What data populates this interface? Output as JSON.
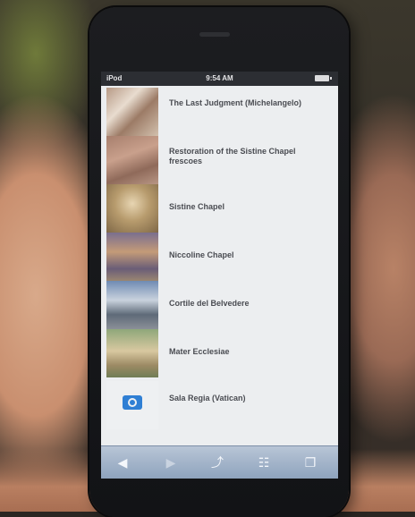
{
  "statusbar": {
    "carrier": "iPod",
    "time": "9:54 AM"
  },
  "list": {
    "items": [
      {
        "title": "The Last Judgment (Michelangelo)",
        "subtitle": ""
      },
      {
        "title": "Restoration of the Sistine Chapel frescoes",
        "subtitle": ""
      },
      {
        "title": "Sistine Chapel",
        "subtitle": ""
      },
      {
        "title": "Niccoline Chapel",
        "subtitle": ""
      },
      {
        "title": "Cortile del Belvedere",
        "subtitle": ""
      },
      {
        "title": "Mater Ecclesiae",
        "subtitle": ""
      },
      {
        "title": "Sala Regia (Vatican)",
        "subtitle": ""
      }
    ]
  },
  "toolbar": {
    "buttons": [
      "back-icon",
      "forward-icon",
      "share-icon",
      "bookmarks-icon",
      "tabs-icon"
    ]
  },
  "colors": {
    "accent": "#2f7fd4",
    "toolbar": "#9fb1c8",
    "statusbar": "#2c2e33"
  }
}
